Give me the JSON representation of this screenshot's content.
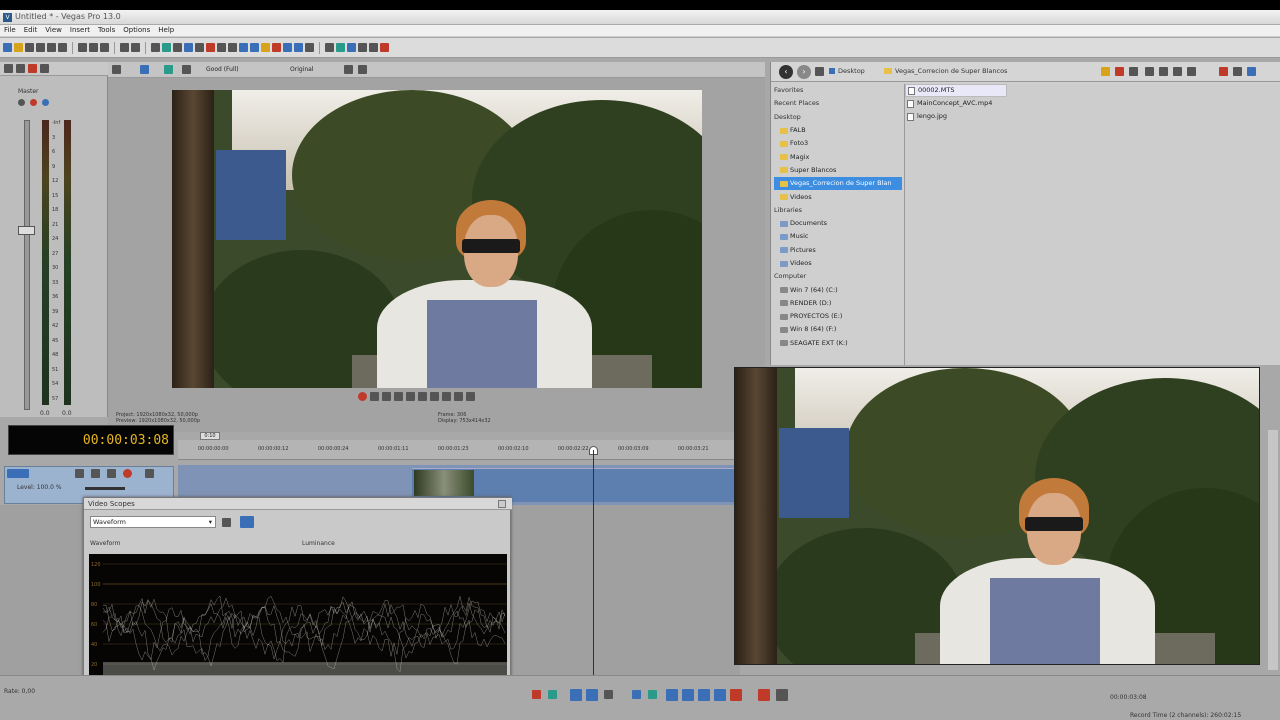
{
  "window": {
    "title": "Untitled * - Vegas Pro 13.0",
    "logo": "V"
  },
  "menu": [
    "File",
    "Edit",
    "View",
    "Insert",
    "Tools",
    "Options",
    "Help"
  ],
  "mixer": {
    "bus_label": "Master",
    "scale": [
      "-Inf",
      "3",
      "6",
      "9",
      "12",
      "15",
      "18",
      "21",
      "24",
      "27",
      "30",
      "33",
      "36",
      "39",
      "42",
      "45",
      "48",
      "51",
      "54",
      "57"
    ],
    "level_left": "0.0",
    "level_right": "0.0"
  },
  "preview": {
    "quality": "Good (Full)",
    "display": "Original",
    "project_label": "Project:",
    "project_value": "1920x1080x32, 50,000p",
    "preview_label": "Preview:",
    "preview_value": "1920x1080x32, 50,000p",
    "frame_label": "Frame:",
    "frame_value": "306",
    "display_label": "Display:",
    "display_value": "753x414x32"
  },
  "explorer": {
    "breadcrumb_root": "Desktop",
    "breadcrumb_folder": "Vegas_Correcion de Super Blancos",
    "tree": [
      {
        "label": "Favorites",
        "type": "section"
      },
      {
        "label": "Recent Places",
        "type": "section"
      },
      {
        "label": "Desktop",
        "type": "section"
      },
      {
        "label": "FALB",
        "type": "folder"
      },
      {
        "label": "Foto3",
        "type": "folder"
      },
      {
        "label": "Magix",
        "type": "folder"
      },
      {
        "label": "Super Blancos",
        "type": "folder"
      },
      {
        "label": "Vegas_Correcion de Super Blan",
        "type": "folder",
        "selected": true
      },
      {
        "label": "Videos",
        "type": "folder"
      },
      {
        "label": "Libraries",
        "type": "section"
      },
      {
        "label": "Documents",
        "type": "lib"
      },
      {
        "label": "Music",
        "type": "lib"
      },
      {
        "label": "Pictures",
        "type": "lib"
      },
      {
        "label": "Videos",
        "type": "lib"
      },
      {
        "label": "Computer",
        "type": "section"
      },
      {
        "label": "Win 7 (64) (C:)",
        "type": "drive"
      },
      {
        "label": "RENDER (D:)",
        "type": "drive"
      },
      {
        "label": "PROYECTOS (E:)",
        "type": "drive"
      },
      {
        "label": "Win 8 (64) (F:)",
        "type": "drive"
      },
      {
        "label": "SEAGATE EXT (K:)",
        "type": "drive"
      }
    ],
    "files": [
      {
        "name": "00002.MTS",
        "selected": true
      },
      {
        "name": "MainConcept_AVC.mp4",
        "selected": false
      },
      {
        "name": "lengo.jpg",
        "selected": false
      }
    ]
  },
  "timeline": {
    "timecode": "00:00:03:08",
    "loop_marker": "0:10",
    "ruler_ticks": [
      "00:00:00:00",
      "00:00:00:12",
      "00:00:00:24",
      "00:00:01:11",
      "00:00:01:23",
      "00:00:02:10",
      "00:00:02:22",
      "00:00:03:09",
      "00:00:03:21"
    ],
    "track_level": "Level: 100.0 %"
  },
  "scopes": {
    "title": "Video Scopes",
    "selected_scope": "Waveform",
    "panel_label": "Waveform",
    "channel": "Luminance",
    "scale": [
      "120",
      "100",
      "80",
      "60",
      "40",
      "20",
      "0",
      "-20"
    ]
  },
  "status": {
    "rate": "Rate: 0,00",
    "position": "00:00:03:08",
    "record_time": "Record Time (2 channels): 260:02:15"
  }
}
